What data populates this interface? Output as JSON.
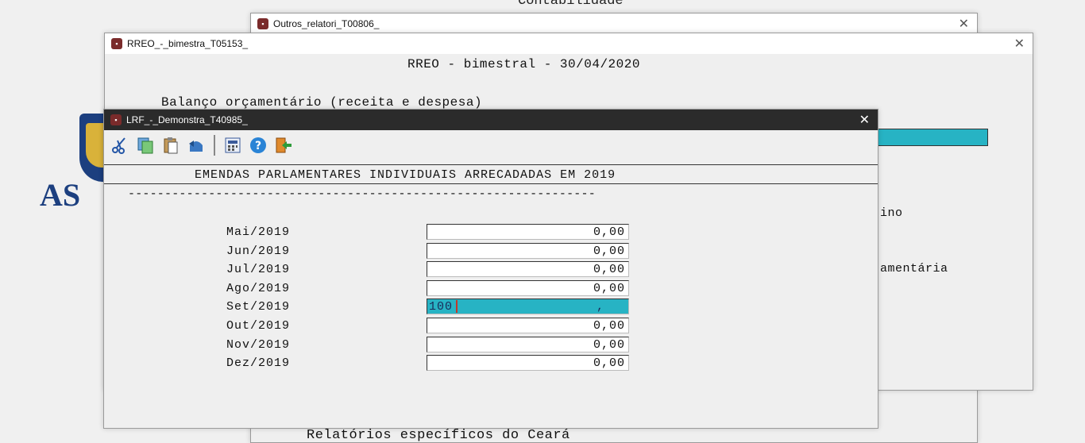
{
  "desktop": {
    "bg_text_top": "Contabilidade",
    "bg_text_bottom": "Relatórios específicos do Ceará",
    "logo_text": "AS"
  },
  "win_outros": {
    "title": "Outros_relatori_T00806_"
  },
  "win_rreo": {
    "title": "RREO_-_bimestra_T05153_",
    "heading": "RREO - bimestral - 30/04/2020",
    "line1": "Balanço orçamentário (receita e despesa)",
    "partial_right1": "ino",
    "partial_right2": "amentária"
  },
  "win_lrf": {
    "title": "LRF_-_Demonstra_T40985_",
    "header": "EMENDAS PARLAMENTARES INDIVIDUAIS ARRECADADAS EM 2019",
    "dashes": "----------------------------------------------------------------",
    "toolbar": [
      {
        "name": "cut-icon"
      },
      {
        "name": "copy-icon"
      },
      {
        "name": "paste-icon"
      },
      {
        "name": "undo-icon"
      },
      {
        "name": "calculator-icon"
      },
      {
        "name": "help-icon"
      },
      {
        "name": "exit-icon"
      }
    ],
    "rows": [
      {
        "label": "Mai/2019",
        "value": "0,00"
      },
      {
        "label": "Jun/2019",
        "value": "0,00"
      },
      {
        "label": "Jul/2019",
        "value": "0,00"
      },
      {
        "label": "Ago/2019",
        "value": "0,00"
      },
      {
        "label": "Set/2019",
        "value": "100",
        "active": true,
        "suffix": ","
      },
      {
        "label": "Out/2019",
        "value": "0,00"
      },
      {
        "label": "Nov/2019",
        "value": "0,00"
      },
      {
        "label": "Dez/2019",
        "value": "0,00"
      }
    ]
  },
  "colors": {
    "active_field": "#27b3c4",
    "dark_titlebar": "#2b2b2b",
    "logo_blue": "#1c3f7f"
  }
}
